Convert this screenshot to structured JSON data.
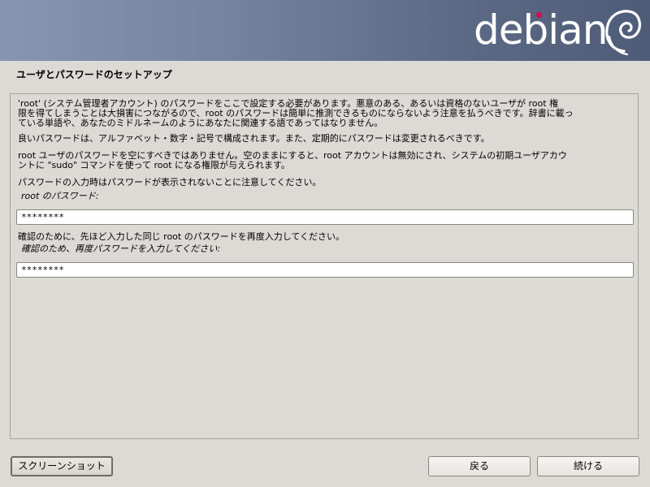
{
  "banner": {
    "logo_text": "debian",
    "brand_color": "#d70751"
  },
  "page": {
    "title": "ユーザとパスワードのセットアップ"
  },
  "content": {
    "paragraph1": "'root' (システム管理者アカウント) のパスワードをここで設定する必要があります。悪意のある、あるいは資格のないユーザが root 権\n限を得てしまうことは大損害につながるので、root のパスワードは簡単に推測できるものにならないよう注意を払うべきです。辞書に載っ\nている単語や、あなたのミドルネームのようにあなたに関連する語であってはなりません。",
    "paragraph2": "良いパスワードは、アルファベット・数字・記号で構成されます。また、定期的にパスワードは変更されるべきです。",
    "paragraph3": "root ユーザのパスワードを空にすべきではありません。空のままにすると、root アカウントは無効にされ、システムの初期ユーザアカウ\nントに \"sudo\" コマンドを使って root になる権限が与えられます。",
    "paragraph4": "パスワードの入力時はパスワードが表示されないことに注意してください。",
    "root_password_label": "root のパスワード:",
    "root_password_value": "********",
    "confirm_paragraph": "確認のために、先ほど入力した同じ root のパスワードを再度入力してください。",
    "confirm_label": "確認のため、再度パスワードを入力してください:",
    "confirm_password_value": "********"
  },
  "buttons": {
    "screenshot": "スクリーンショット",
    "back": "戻る",
    "continue": "続ける"
  }
}
